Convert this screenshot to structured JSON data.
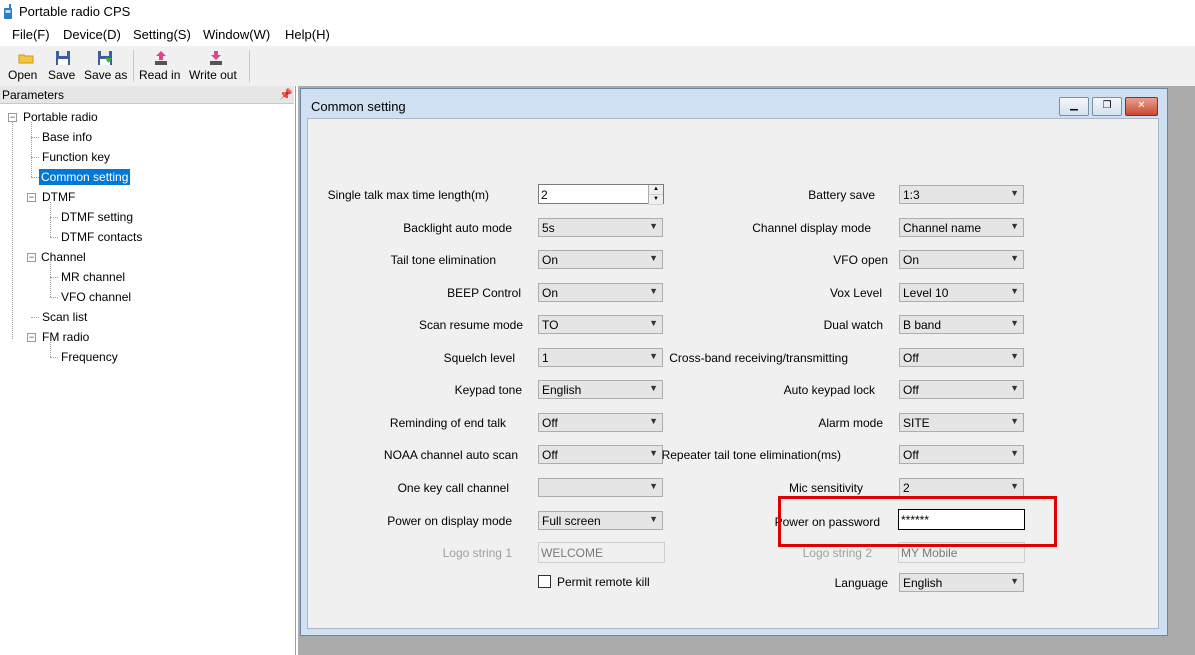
{
  "window": {
    "title": "Portable radio CPS"
  },
  "menu": [
    "File(F)",
    "Device(D)",
    "Setting(S)",
    "Window(W)",
    "Help(H)"
  ],
  "toolbar": {
    "open": "Open",
    "save": "Save",
    "save_as": "Save as",
    "read_in": "Read in",
    "write_out": "Write out"
  },
  "params": {
    "title": "Parameters",
    "tree": {
      "root": "Portable radio",
      "base_info": "Base info",
      "function_key": "Function key",
      "common_setting": "Common setting",
      "dtmf": "DTMF",
      "dtmf_setting": "DTMF setting",
      "dtmf_contacts": "DTMF contacts",
      "channel": "Channel",
      "mr_channel": "MR channel",
      "vfo_channel": "VFO channel",
      "scan_list": "Scan list",
      "fm_radio": "FM radio",
      "frequency": "Frequency"
    }
  },
  "child": {
    "title": "Common setting"
  },
  "form": {
    "single_talk": {
      "label": "Single talk max time length(m)",
      "value": "2"
    },
    "backlight": {
      "label": "Backlight auto mode",
      "value": "5s"
    },
    "tail_tone": {
      "label": "Tail tone elimination",
      "value": "On"
    },
    "beep": {
      "label": "BEEP Control",
      "value": "On"
    },
    "scan_resume": {
      "label": "Scan resume mode",
      "value": "TO"
    },
    "squelch": {
      "label": "Squelch level",
      "value": "1"
    },
    "keypad_tone": {
      "label": "Keypad tone",
      "value": "English"
    },
    "reminding": {
      "label": "Reminding of end talk",
      "value": "Off"
    },
    "noaa": {
      "label": "NOAA channel auto scan",
      "value": "Off"
    },
    "one_key_call": {
      "label": "One key call channel",
      "value": ""
    },
    "power_on_display": {
      "label": "Power on display mode",
      "value": "Full screen"
    },
    "logo1": {
      "label": "Logo string 1",
      "value": "WELCOME"
    },
    "permit_kill": {
      "label": "Permit remote kill",
      "checked": false
    },
    "battery_save": {
      "label": "Battery save",
      "value": "1:3"
    },
    "channel_display": {
      "label": "Channel display mode",
      "value": "Channel name"
    },
    "vfo_open": {
      "label": "VFO open",
      "value": "On"
    },
    "vox_level": {
      "label": "Vox Level",
      "value": "Level 10"
    },
    "dual_watch": {
      "label": "Dual watch",
      "value": "B band"
    },
    "cross_band": {
      "label": "Cross-band receiving/transmitting",
      "value": "Off"
    },
    "auto_keypad_lock": {
      "label": "Auto keypad lock",
      "value": "Off"
    },
    "alarm_mode": {
      "label": "Alarm mode",
      "value": "SITE"
    },
    "repeater_tail": {
      "label": "Repeater tail tone elimination(ms)",
      "value": "Off"
    },
    "mic_sensitivity": {
      "label": "Mic sensitivity",
      "value": "2"
    },
    "power_on_password": {
      "label": "Power on password",
      "value": "******"
    },
    "logo2": {
      "label": "Logo string 2",
      "value": "MY Mobile"
    },
    "language": {
      "label": "Language",
      "value": "English"
    }
  },
  "colors": {
    "highlight": "#e00000",
    "selection": "#0078d7"
  }
}
